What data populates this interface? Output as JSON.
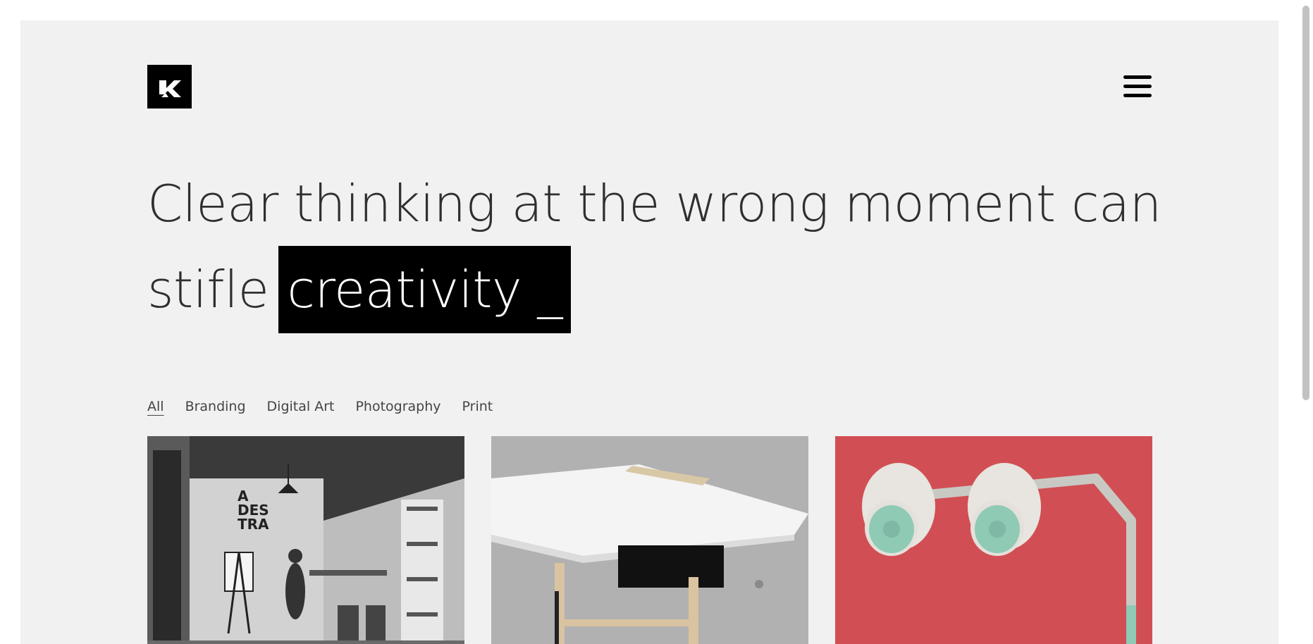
{
  "header": {
    "logo_icon": "k-logo-icon",
    "menu_icon": "hamburger-menu-icon"
  },
  "hero": {
    "line1": "Clear thinking at the wrong moment can",
    "line2_prefix": "stifle",
    "highlight": "creativity _"
  },
  "filters": {
    "items": [
      {
        "label": "All",
        "active": true
      },
      {
        "label": "Branding",
        "active": false
      },
      {
        "label": "Digital Art",
        "active": false
      },
      {
        "label": "Photography",
        "active": false
      },
      {
        "label": "Print",
        "active": false
      }
    ]
  },
  "portfolio": {
    "items": [
      {
        "image": "office-studio-bw-photo"
      },
      {
        "image": "white-desk-photo"
      },
      {
        "image": "mint-lamps-on-red-photo"
      }
    ]
  },
  "colors": {
    "background": "#f1f1f1",
    "text": "#2f2f2f",
    "highlight_bg": "#000000",
    "highlight_text": "#ffffff",
    "card3_bg": "#d14f54",
    "lamp_mint": "#8fcab5"
  }
}
